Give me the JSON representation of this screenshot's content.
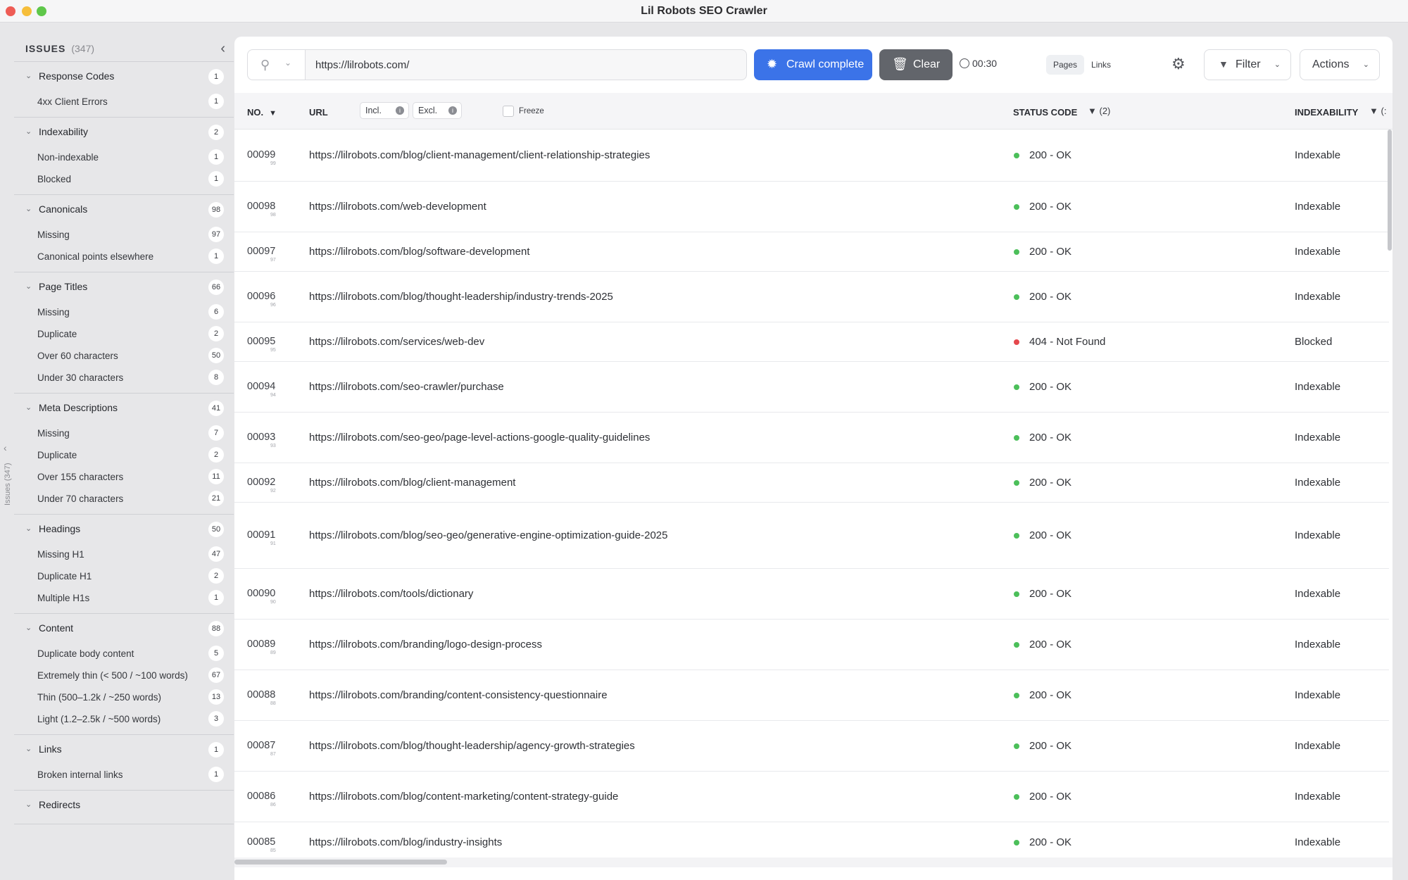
{
  "window": {
    "title": "Lil Robots SEO Crawler"
  },
  "rail": {
    "label": "Issues (347)"
  },
  "sidebar": {
    "title": "ISSUES",
    "count": "(347)",
    "groups": [
      {
        "label": "Response Codes",
        "count": "1",
        "items": [
          {
            "label": "4xx Client Errors",
            "count": "1"
          }
        ]
      },
      {
        "label": "Indexability",
        "count": "2",
        "items": [
          {
            "label": "Non-indexable",
            "count": "1"
          },
          {
            "label": "Blocked",
            "count": "1"
          }
        ]
      },
      {
        "label": "Canonicals",
        "count": "98",
        "items": [
          {
            "label": "Missing",
            "count": "97"
          },
          {
            "label": "Canonical points elsewhere",
            "count": "1"
          }
        ]
      },
      {
        "label": "Page Titles",
        "count": "66",
        "items": [
          {
            "label": "Missing",
            "count": "6"
          },
          {
            "label": "Duplicate",
            "count": "2"
          },
          {
            "label": "Over 60 characters",
            "count": "50"
          },
          {
            "label": "Under 30 characters",
            "count": "8"
          }
        ]
      },
      {
        "label": "Meta Descriptions",
        "count": "41",
        "items": [
          {
            "label": "Missing",
            "count": "7"
          },
          {
            "label": "Duplicate",
            "count": "2"
          },
          {
            "label": "Over 155 characters",
            "count": "11"
          },
          {
            "label": "Under 70 characters",
            "count": "21"
          }
        ]
      },
      {
        "label": "Headings",
        "count": "50",
        "items": [
          {
            "label": "Missing H1",
            "count": "47"
          },
          {
            "label": "Duplicate H1",
            "count": "2"
          },
          {
            "label": "Multiple H1s",
            "count": "1"
          }
        ]
      },
      {
        "label": "Content",
        "count": "88",
        "items": [
          {
            "label": "Duplicate body content",
            "count": "5"
          },
          {
            "label": "Extremely thin (< 500 / ~100 words)",
            "count": "67"
          },
          {
            "label": "Thin (500–1.2k / ~250 words)",
            "count": "13"
          },
          {
            "label": "Light (1.2–2.5k / ~500 words)",
            "count": "3"
          }
        ]
      },
      {
        "label": "Links",
        "count": "1",
        "items": [
          {
            "label": "Broken internal links",
            "count": "1"
          }
        ]
      },
      {
        "label": "Redirects",
        "count": "",
        "items": []
      }
    ]
  },
  "toolbar": {
    "url_value": "https://lilrobots.com/",
    "crawl_label": "Crawl complete",
    "clear_label": "Clear",
    "timer": "00:30",
    "tabs": [
      {
        "label": "Pages",
        "active": true
      },
      {
        "label": "Links",
        "active": false
      }
    ],
    "filter_label": "Filter",
    "actions_label": "Actions"
  },
  "table": {
    "headers": {
      "no": "NO.",
      "url": "URL",
      "incl": "Incl.",
      "excl": "Excl.",
      "freeze": "Freeze",
      "status": "STATUS CODE",
      "status_filter_count": "(2)",
      "indexability": "INDEXABILITY",
      "indexability_filter_count": "(:"
    },
    "rows": [
      {
        "no": "00099",
        "sub": "99",
        "url": "https://lilrobots.com/blog/client-management/client-relationship-strategies",
        "status": "200 - OK",
        "ok": true,
        "indexability": "Indexable"
      },
      {
        "no": "00098",
        "sub": "98",
        "url": "https://lilrobots.com/web-development",
        "status": "200 - OK",
        "ok": true,
        "indexability": "Indexable"
      },
      {
        "no": "00097",
        "sub": "97",
        "url": "https://lilrobots.com/blog/software-development",
        "status": "200 - OK",
        "ok": true,
        "indexability": "Indexable"
      },
      {
        "no": "00096",
        "sub": "96",
        "url": "https://lilrobots.com/blog/thought-leadership/industry-trends-2025",
        "status": "200 - OK",
        "ok": true,
        "indexability": "Indexable"
      },
      {
        "no": "00095",
        "sub": "95",
        "url": "https://lilrobots.com/services/web-dev",
        "status": "404 - Not Found",
        "ok": false,
        "indexability": "Blocked"
      },
      {
        "no": "00094",
        "sub": "94",
        "url": "https://lilrobots.com/seo-crawler/purchase",
        "status": "200 - OK",
        "ok": true,
        "indexability": "Indexable"
      },
      {
        "no": "00093",
        "sub": "93",
        "url": "https://lilrobots.com/seo-geo/page-level-actions-google-quality-guidelines",
        "status": "200 - OK",
        "ok": true,
        "indexability": "Indexable"
      },
      {
        "no": "00092",
        "sub": "92",
        "url": "https://lilrobots.com/blog/client-management",
        "status": "200 - OK",
        "ok": true,
        "indexability": "Indexable"
      },
      {
        "no": "00091",
        "sub": "91",
        "url": "https://lilrobots.com/blog/seo-geo/generative-engine-optimization-guide-2025",
        "status": "200 - OK",
        "ok": true,
        "indexability": "Indexable"
      },
      {
        "no": "00090",
        "sub": "90",
        "url": "https://lilrobots.com/tools/dictionary",
        "status": "200 - OK",
        "ok": true,
        "indexability": "Indexable"
      },
      {
        "no": "00089",
        "sub": "89",
        "url": "https://lilrobots.com/branding/logo-design-process",
        "status": "200 - OK",
        "ok": true,
        "indexability": "Indexable"
      },
      {
        "no": "00088",
        "sub": "88",
        "url": "https://lilrobots.com/branding/content-consistency-questionnaire",
        "status": "200 - OK",
        "ok": true,
        "indexability": "Indexable"
      },
      {
        "no": "00087",
        "sub": "87",
        "url": "https://lilrobots.com/blog/thought-leadership/agency-growth-strategies",
        "status": "200 - OK",
        "ok": true,
        "indexability": "Indexable"
      },
      {
        "no": "00086",
        "sub": "86",
        "url": "https://lilrobots.com/blog/content-marketing/content-strategy-guide",
        "status": "200 - OK",
        "ok": true,
        "indexability": "Indexable"
      },
      {
        "no": "00085",
        "sub": "85",
        "url": "https://lilrobots.com/blog/industry-insights",
        "status": "200 - OK",
        "ok": true,
        "indexability": "Indexable"
      }
    ]
  },
  "colors": {
    "accent": "#3b73e8",
    "ok": "#4cbf5a",
    "error": "#e5484d",
    "clear": "#62656b"
  }
}
